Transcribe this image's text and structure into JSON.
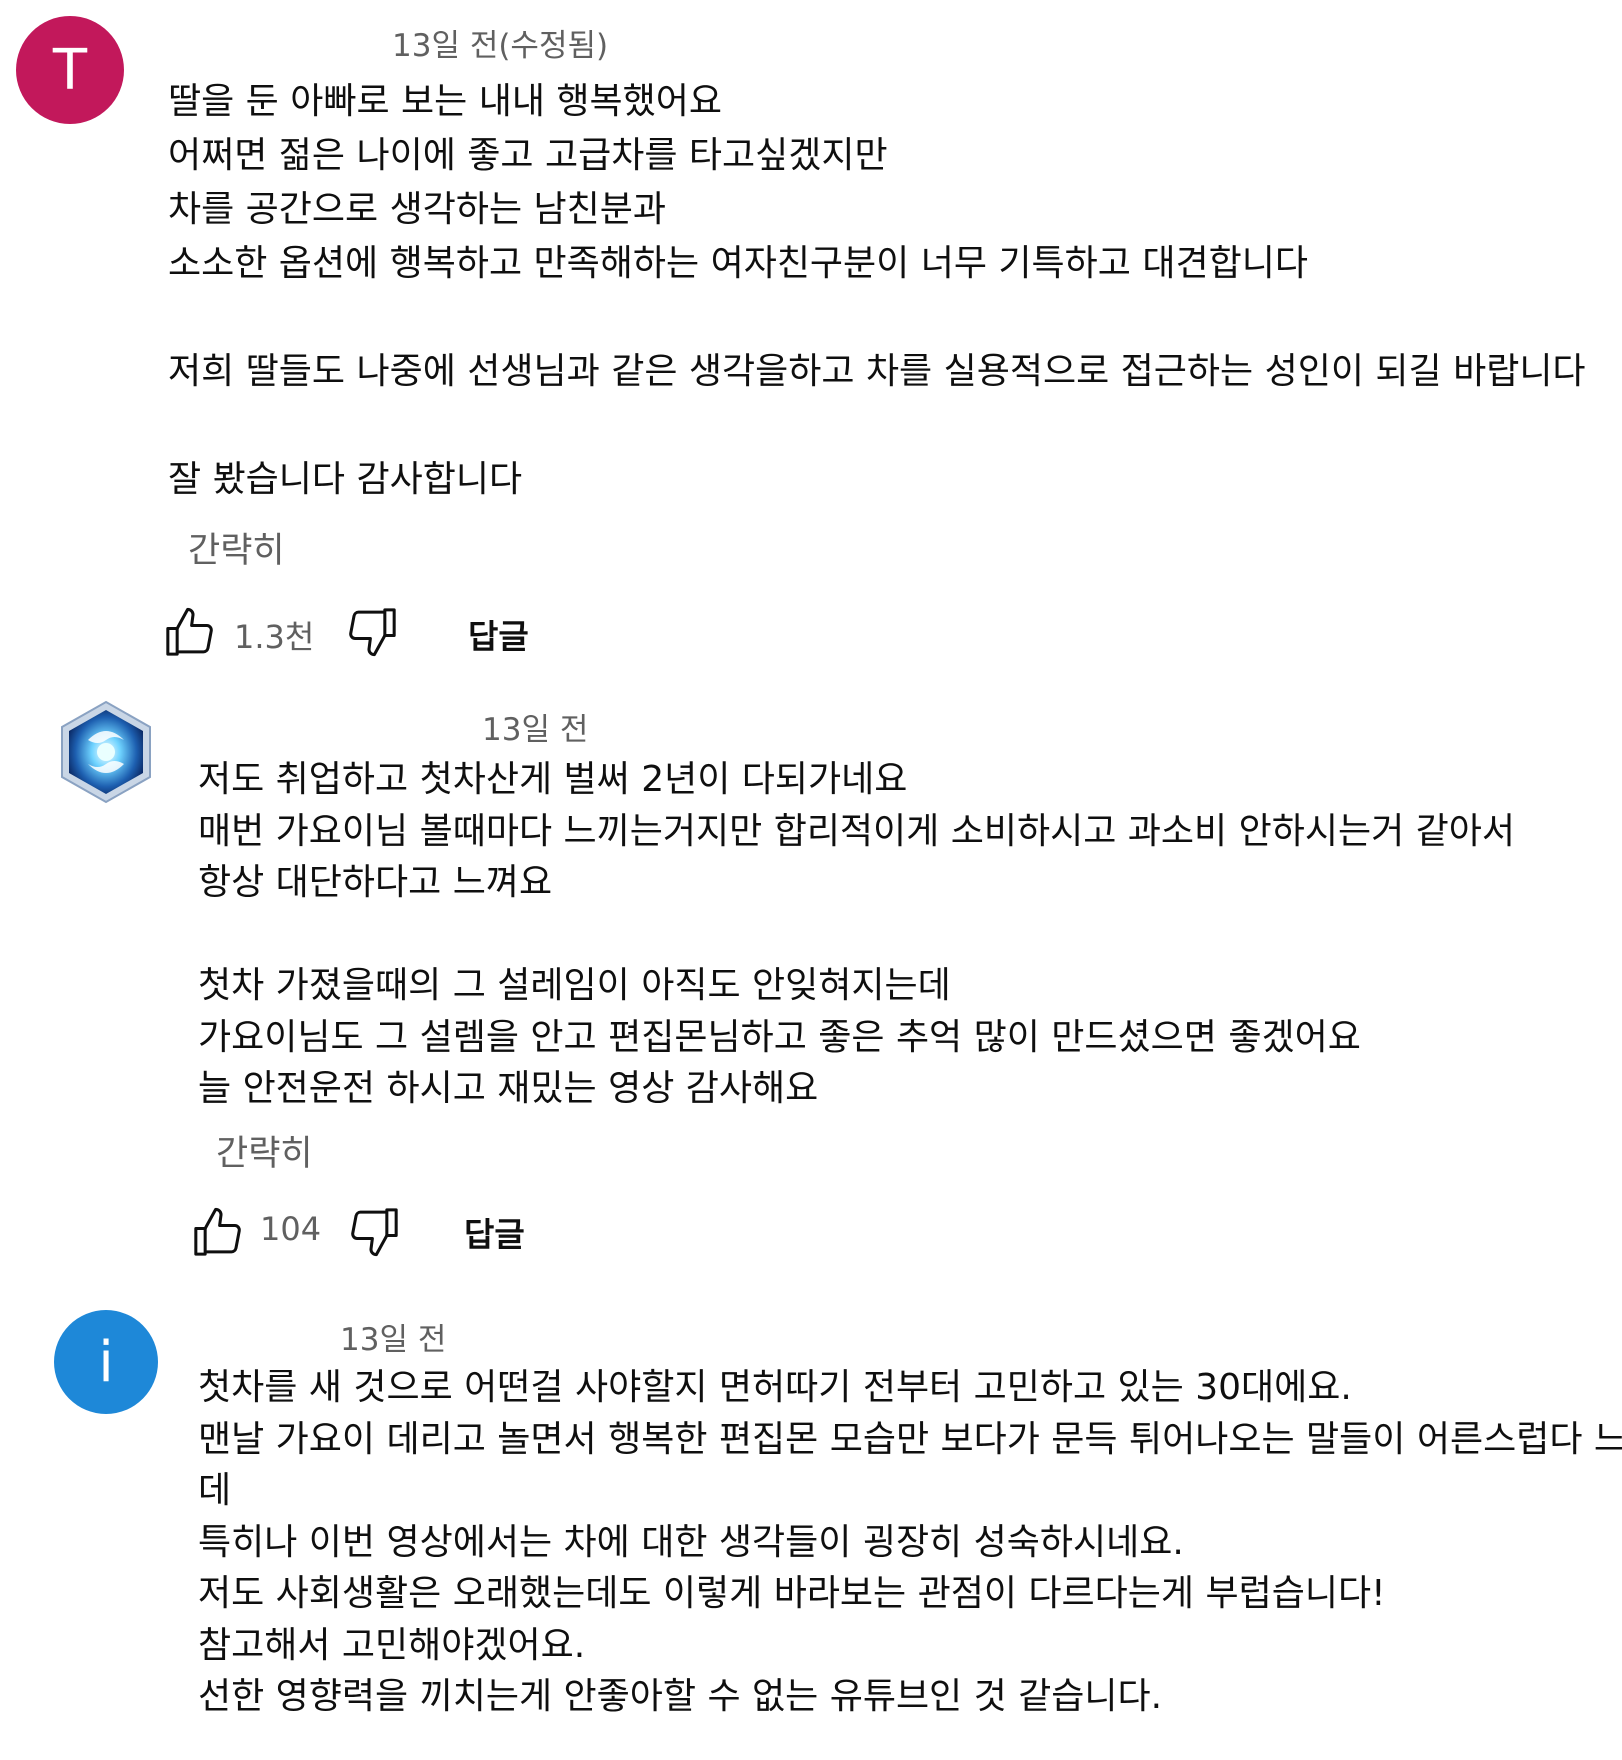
{
  "comments": [
    {
      "avatar_letter": "T",
      "avatar_color": "#c2185b",
      "timestamp": "13일 전(수정됨)",
      "text": "딸을 둔 아빠로 보는 내내 행복했어요\n어쩌면 젊은 나이에 좋고 고급차를 타고싶겠지만\n차를 공간으로 생각하는 남친분과\n소소한 옵션에 행복하고 만족해하는 여자친구분이 너무 기특하고 대견합니다\n\n저희 딸들도 나중에 선생님과 같은 생각을하고 차를 실용적으로 접근하는 성인이 되길 바랍니다\n\n잘 봤습니다 감사합니다",
      "collapse_label": "간략히",
      "like_count": "1.3천",
      "reply_label": "답글"
    },
    {
      "avatar_icon": "heroes-emblem-icon",
      "timestamp": "13일 전",
      "text": "저도 취업하고 첫차산게 벌써 2년이 다되가네요\n매번 가요이님 볼때마다 느끼는거지만 합리적이게 소비하시고 과소비 안하시는거 같아서\n항상 대단하다고 느껴요\n\n첫차 가졌을때의 그 설레임이 아직도 안잊혀지는데\n가요이님도 그 설렘을 안고 편집몬님하고 좋은 추억 많이 만드셨으면 좋겠어요\n늘 안전운전 하시고 재밌는 영상 감사해요",
      "collapse_label": "간략히",
      "like_count": "104",
      "reply_label": "답글"
    },
    {
      "avatar_letter": "i",
      "avatar_color": "#1e88d8",
      "timestamp": "13일 전",
      "text": "첫차를 새 것으로 어떤걸 사야할지 면허따기 전부터 고민하고 있는 30대에요.\n맨날 가요이 데리고 놀면서 행복한 편집몬 모습만 보다가 문득 튀어나오는 말들이 어른스럽다 느꼈는\n데\n특히나 이번 영상에서는 차에 대한 생각들이 굉장히 성숙하시네요.\n저도 사회생활은 오래했는데도 이렇게 바라보는 관점이 다르다는게 부럽습니다!\n참고해서 고민해야겠어요.\n선한 영향력을 끼치는게 안좋아할 수 없는 유튜브인 것 같습니다."
    }
  ]
}
